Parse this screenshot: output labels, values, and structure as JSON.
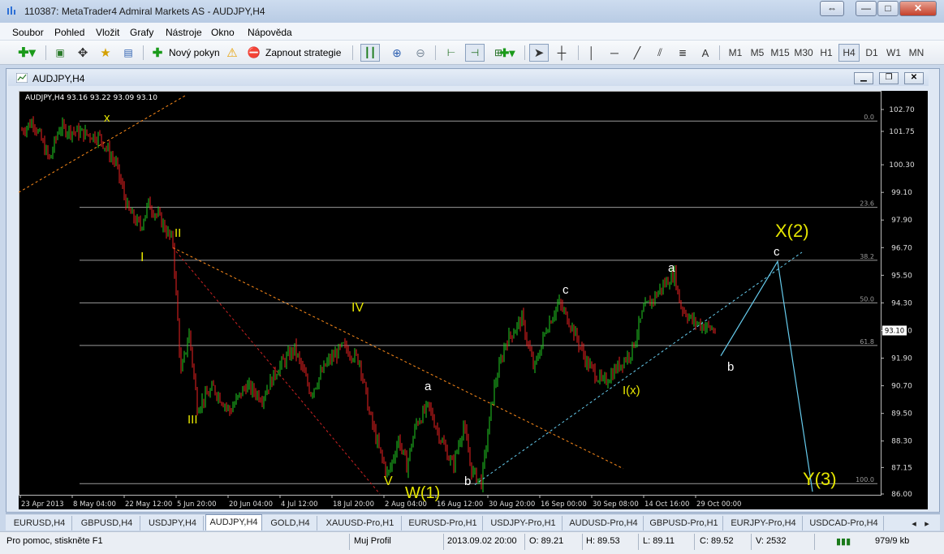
{
  "window": {
    "title": "110387: MetaTrader4 Admiral Markets AS - AUDJPY,H4",
    "controls": [
      "⇔",
      "—",
      "□",
      "✕"
    ]
  },
  "menu": [
    "Soubor",
    "Pohled",
    "Vložit",
    "Grafy",
    "Nástroje",
    "Okno",
    "Nápověda"
  ],
  "toolbar": {
    "new_order": "Nový pokyn",
    "autotrading": "Zapnout strategie",
    "object_text": "A",
    "timeframes": [
      "M1",
      "M5",
      "M15",
      "M30",
      "H1",
      "H4",
      "D1",
      "W1",
      "MN"
    ],
    "active_timeframe": "H4"
  },
  "chart_window": {
    "title": "AUDJPY,H4",
    "info": "AUDJPY,H4  93.16 93.22 93.09 93.10"
  },
  "chart_data": {
    "type": "candlestick",
    "symbol": "AUDJPY",
    "timeframe": "H4",
    "ohlc_header": {
      "open": 93.16,
      "high": 93.22,
      "low": 93.09,
      "close": 93.1
    },
    "current_price": "93.10",
    "ylim": [
      86.0,
      103.3
    ],
    "price_ticks": [
      "102.70",
      "101.75",
      "100.30",
      "99.10",
      "97.90",
      "96.70",
      "95.50",
      "94.30",
      "93.10",
      "91.90",
      "90.70",
      "89.50",
      "88.30",
      "87.15",
      "86.00"
    ],
    "time_ticks": [
      "23 Apr 2013",
      "8 May 04:00",
      "22 May 12:00",
      "5 Jun 20:00",
      "20 Jun 04:00",
      "4 Jul 12:00",
      "18 Jul 20:00",
      "2 Aug 04:00",
      "16 Aug 12:00",
      "30 Aug 20:00",
      "16 Sep 00:00",
      "30 Sep 08:00",
      "14 Oct 16:00",
      "29 Oct 00:00"
    ],
    "fibonacci_levels": [
      {
        "label": "0.0",
        "price": 102.2
      },
      {
        "label": "23.6",
        "price": 98.45
      },
      {
        "label": "38.2",
        "price": 96.15
      },
      {
        "label": "50.0",
        "price": 94.3
      },
      {
        "label": "61.8",
        "price": 92.45
      },
      {
        "label": "100.0",
        "price": 86.45
      }
    ],
    "wave_labels": [
      {
        "text": "x",
        "color": "#e6e600"
      },
      {
        "text": "I",
        "color": "#e6e600"
      },
      {
        "text": "II",
        "color": "#e6e600"
      },
      {
        "text": "III",
        "color": "#e6e600"
      },
      {
        "text": "IV",
        "color": "#e6e600"
      },
      {
        "text": "V",
        "color": "#e6e600"
      },
      {
        "text": "W(1)",
        "color": "#e6e600"
      },
      {
        "text": "a",
        "color": "#ffffff"
      },
      {
        "text": "b",
        "color": "#ffffff"
      },
      {
        "text": "c",
        "color": "#ffffff"
      },
      {
        "text": "I(x)",
        "color": "#e6e600"
      },
      {
        "text": "a",
        "color": "#ffffff"
      },
      {
        "text": "b",
        "color": "#ffffff"
      },
      {
        "text": "X(2)",
        "color": "#e6e600"
      },
      {
        "text": "c",
        "color": "#ffffff"
      },
      {
        "text": "Y(3)",
        "color": "#e6e600"
      }
    ],
    "colors": {
      "background": "#000000",
      "bull": "#22cc22",
      "bear": "#ee2222",
      "grid": "#888888",
      "trend": "#ff8c1a",
      "projection": "#66ccee"
    }
  },
  "tabs": [
    "EURUSD,H4",
    "GBPUSD,H4",
    "USDJPY,H4",
    "AUDJPY,H4",
    "GOLD,H4",
    "XAUUSD-Pro,H1",
    "EURUSD-Pro,H1",
    "USDJPY-Pro,H1",
    "AUDUSD-Pro,H4",
    "GBPUSD-Pro,H1",
    "EURJPY-Pro,H4",
    "USDCAD-Pro,H4"
  ],
  "active_tab": "AUDJPY,H4",
  "status": {
    "help": "Pro pomoc, stiskněte F1",
    "profile": "Muj Profil",
    "datetime": "2013.09.02 20:00",
    "open": "O: 89.21",
    "high": "H: 89.53",
    "low": "L: 89.11",
    "close": "C: 89.52",
    "volume": "V: 2532",
    "traffic": "979/9 kb"
  }
}
